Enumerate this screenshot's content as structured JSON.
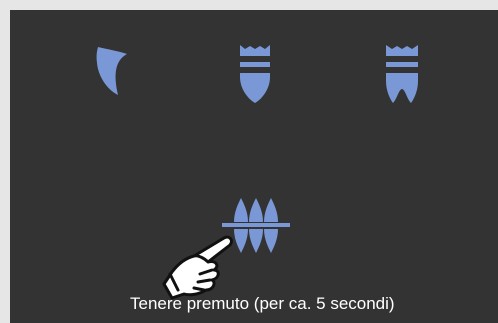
{
  "colors": {
    "frame": "#e6e6e6",
    "panel": "#333333",
    "tooth": "#7b98d6",
    "text": "#ffffff",
    "hand_fill": "#ffffff",
    "hand_stroke": "#111111"
  },
  "tools": [
    {
      "icon": "veneer-icon"
    },
    {
      "icon": "crown-icon"
    },
    {
      "icon": "bridge-icon"
    },
    {
      "icon": "bite-registration-icon"
    }
  ],
  "pointer": {
    "icon": "pointing-hand-icon"
  },
  "hint": {
    "text": "Tenere premuto (per ca. 5 secondi)"
  }
}
